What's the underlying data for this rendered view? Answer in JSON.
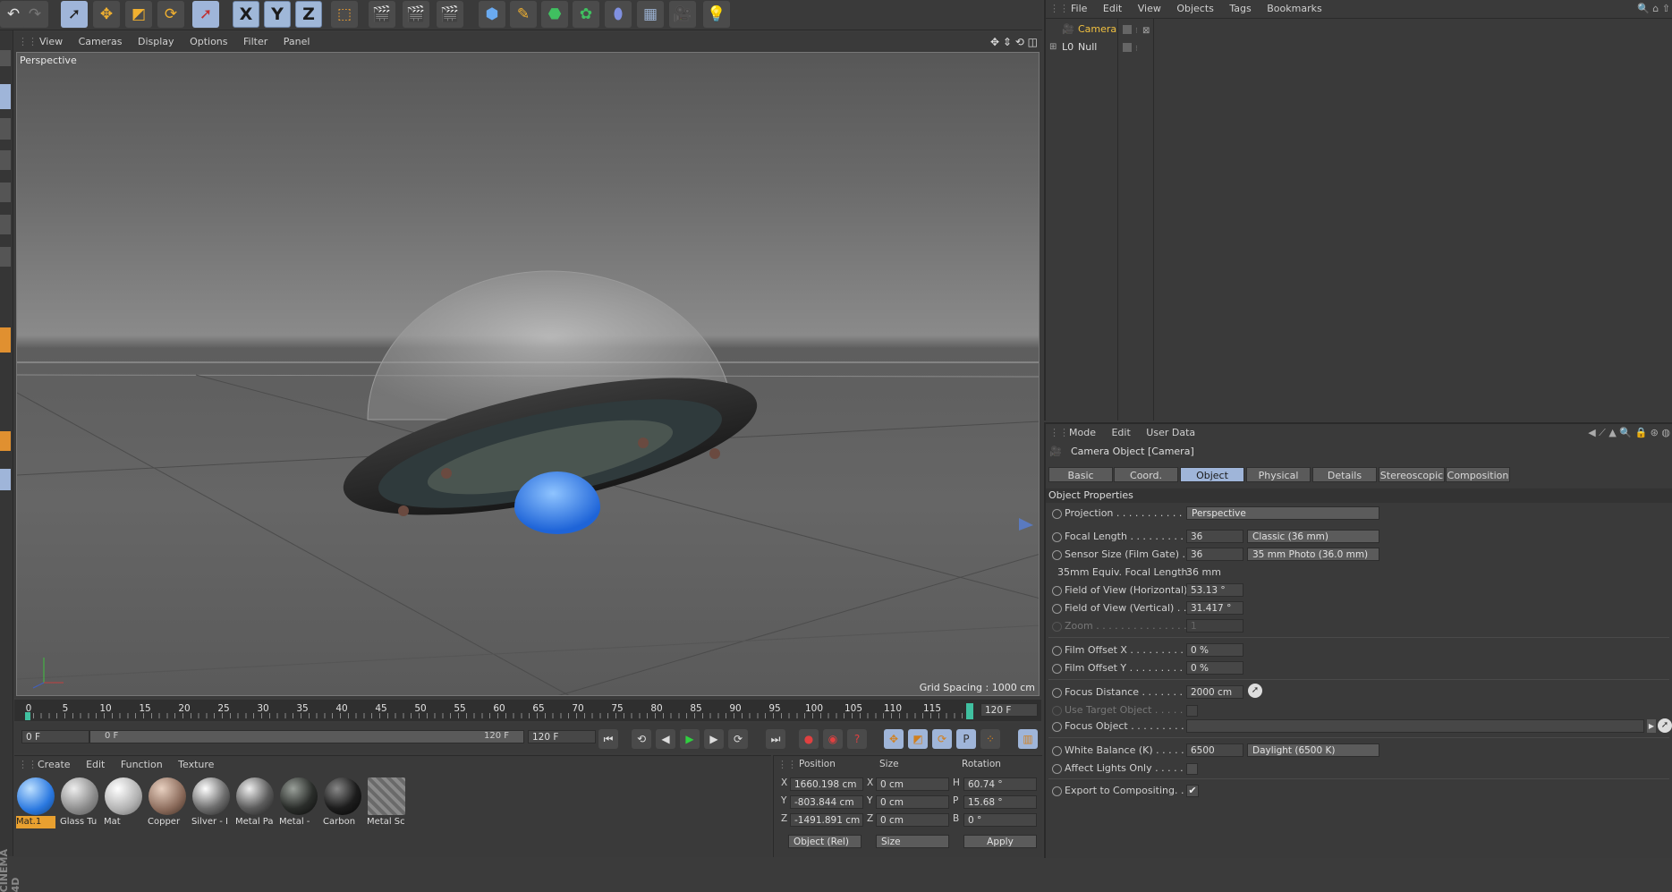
{
  "toolbar": {
    "axes": [
      "X",
      "Y",
      "Z"
    ]
  },
  "viewport": {
    "menu": [
      "View",
      "Cameras",
      "Display",
      "Options",
      "Filter",
      "Panel"
    ],
    "label": "Perspective",
    "grid_spacing": "Grid Spacing : 1000 cm"
  },
  "object_manager": {
    "menu": [
      "File",
      "Edit",
      "View",
      "Objects",
      "Tags",
      "Bookmarks"
    ],
    "items": [
      {
        "name": "Camera"
      },
      {
        "name": "Null"
      }
    ]
  },
  "attributes": {
    "menu": [
      "Mode",
      "Edit",
      "User Data"
    ],
    "title": "Camera Object [Camera]",
    "tabs": [
      "Basic",
      "Coord.",
      "Object",
      "Physical",
      "Details",
      "Stereoscopic",
      "Composition"
    ],
    "active_tab": "Object",
    "section": "Object Properties",
    "rows": {
      "projection": {
        "label": "Projection . . . . . . . . . . . . .",
        "value": "Perspective"
      },
      "focal_length": {
        "label": "Focal Length . . . . . . . . . .",
        "value": "36",
        "preset": "Classic (36 mm)"
      },
      "sensor_size": {
        "label": "Sensor Size (Film Gate) . .",
        "value": "36",
        "preset": "35 mm Photo (36.0 mm)"
      },
      "equiv": {
        "label": "35mm Equiv. Focal Length:",
        "value": "36 mm"
      },
      "fov_h": {
        "label": "Field of View (Horizontal)",
        "value": "53.13 °"
      },
      "fov_v": {
        "label": "Field of View (Vertical) . .",
        "value": "31.417 °"
      },
      "zoom": {
        "label": "Zoom . . . . . . . . . . . . . . . . .",
        "value": "1"
      },
      "film_offset_x": {
        "label": "Film Offset X . . . . . . . . . .",
        "value": "0 %"
      },
      "film_offset_y": {
        "label": "Film Offset Y . . . . . . . . . .",
        "value": "0 %"
      },
      "focus_distance": {
        "label": "Focus Distance . . . . . . . .",
        "value": "2000 cm"
      },
      "use_target": {
        "label": "Use Target Object . . . . . ."
      },
      "focus_object": {
        "label": "Focus Object . . . . . . . . . ."
      },
      "white_balance": {
        "label": "White Balance (K) . . . . . .",
        "value": "6500",
        "preset": "Daylight (6500 K)"
      },
      "affect_lights": {
        "label": "Affect Lights Only . . . . . ."
      },
      "export_comp": {
        "label": "Export to Compositing. . ."
      }
    }
  },
  "timeline": {
    "ticks": [
      "0",
      "5",
      "10",
      "15",
      "20",
      "25",
      "30",
      "35",
      "40",
      "45",
      "50",
      "55",
      "60",
      "65",
      "70",
      "75",
      "80",
      "85",
      "90",
      "95",
      "100",
      "105",
      "110",
      "115"
    ],
    "end_frame": "120 F",
    "current_frame": "0 F",
    "range_start": "0 F",
    "range_end": "120 F",
    "max_frame": "120 F"
  },
  "material_manager": {
    "menu": [
      "Create",
      "Edit",
      "Function",
      "Texture"
    ],
    "materials": [
      {
        "name": "Mat.1",
        "color": "#2a78e0"
      },
      {
        "name": "Glass Tu",
        "color": "#9a9a9a"
      },
      {
        "name": "Mat",
        "color": "#b8b8b8"
      },
      {
        "name": "Copper",
        "color": "#8a6a5a"
      },
      {
        "name": "Silver - I",
        "color": "#6e6e6e"
      },
      {
        "name": "Metal Pa",
        "color": "#5c5c5c"
      },
      {
        "name": "Metal -",
        "color": "#2a2d2a"
      },
      {
        "name": "Carbon",
        "color": "#1c1c1c"
      },
      {
        "name": "Metal Sc",
        "color": "#7a7a7a"
      }
    ]
  },
  "coordinates": {
    "headers": [
      "Position",
      "Size",
      "Rotation"
    ],
    "rows": [
      {
        "axis": "X",
        "pos": "1660.198 cm",
        "size_axis": "X",
        "size": "0 cm",
        "rot_axis": "H",
        "rot": "60.74 °"
      },
      {
        "axis": "Y",
        "pos": "-803.844 cm",
        "size_axis": "Y",
        "size": "0 cm",
        "rot_axis": "P",
        "rot": "15.68 °"
      },
      {
        "axis": "Z",
        "pos": "-1491.891 cm",
        "size_axis": "Z",
        "size": "0 cm",
        "rot_axis": "B",
        "rot": "0 °"
      }
    ],
    "mode": "Object (Rel)",
    "size_mode": "Size",
    "apply": "Apply"
  },
  "brand": "CINEMA 4D",
  "colors": {
    "accent": "#9fb5d9",
    "selected_text": "#f0c040",
    "mat_selected": "#e8a030"
  }
}
